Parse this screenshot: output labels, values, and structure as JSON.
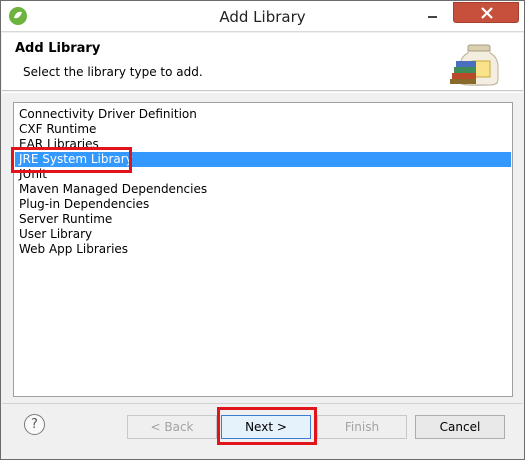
{
  "window": {
    "title": "Add Library"
  },
  "header": {
    "title": "Add Library",
    "description": "Select the library type to add."
  },
  "library_types": [
    {
      "label": "Connectivity Driver Definition",
      "selected": false
    },
    {
      "label": "CXF Runtime",
      "selected": false
    },
    {
      "label": "EAR Libraries",
      "selected": false
    },
    {
      "label": "JRE System Library",
      "selected": true
    },
    {
      "label": "JUnit",
      "selected": false
    },
    {
      "label": "Maven Managed Dependencies",
      "selected": false
    },
    {
      "label": "Plug-in Dependencies",
      "selected": false
    },
    {
      "label": "Server Runtime",
      "selected": false
    },
    {
      "label": "User Library",
      "selected": false
    },
    {
      "label": "Web App Libraries",
      "selected": false
    }
  ],
  "buttons": {
    "help": "?",
    "back": "< Back",
    "next": "Next >",
    "finish": "Finish",
    "cancel": "Cancel"
  },
  "colors": {
    "selection": "#3399ff",
    "highlight": "#e0141b",
    "close_button": "#c7503d"
  }
}
